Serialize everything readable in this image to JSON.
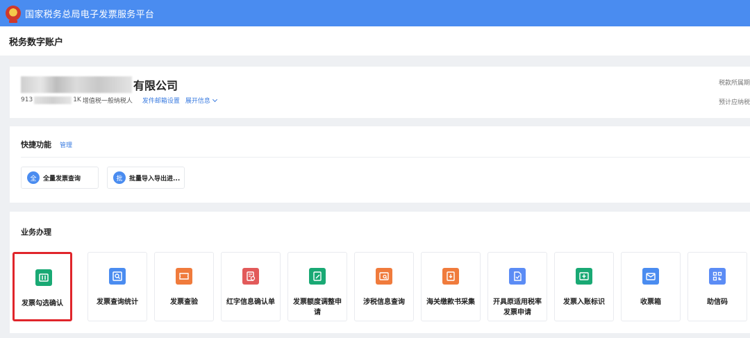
{
  "topbar": {
    "title": "国家税务总局电子发票服务平台",
    "emblem_icon": "national-tax-emblem-icon"
  },
  "page": {
    "title": "税务数字账户"
  },
  "company": {
    "name_visible": "有限公司",
    "tax_id_prefix": "913",
    "tax_id_suffix": "1K",
    "taxpayer_type": "增值税一般纳税人",
    "mail_settings_link": "发件邮箱设置",
    "expand_info_link": "展开信息",
    "right_label_1": "税款所属期",
    "right_label_2": "预计应纳税"
  },
  "quick": {
    "title": "快捷功能",
    "manage_label": "管理",
    "items": [
      {
        "icon_char": "全",
        "label": "全量发票查询"
      },
      {
        "icon_char": "批",
        "label": "批量导入导出进..."
      }
    ]
  },
  "business": {
    "title": "业务办理",
    "tiles": [
      {
        "label": "发票勾选确认",
        "icon": "invoice-check-icon",
        "color": "#19a974"
      },
      {
        "label": "发票查询统计",
        "icon": "invoice-search-icon",
        "color": "#4a8cf0"
      },
      {
        "label": "发票查验",
        "icon": "ticket-verify-icon",
        "color": "#f07b3c"
      },
      {
        "label": "红字信息确认单",
        "icon": "red-info-icon",
        "color": "#e25a5a"
      },
      {
        "label": "发票额度调整申请",
        "icon": "quota-adjust-icon",
        "color": "#19a974"
      },
      {
        "label": "涉税信息查询",
        "icon": "tax-info-search-icon",
        "color": "#f07b3c"
      },
      {
        "label": "海关缴款书采集",
        "icon": "customs-collect-icon",
        "color": "#f07b3c"
      },
      {
        "label": "开具原适用税率发票申请",
        "icon": "tax-rate-apply-icon",
        "color": "#5b8cf5"
      },
      {
        "label": "发票入账标识",
        "icon": "accounting-mark-icon",
        "color": "#19a974"
      },
      {
        "label": "收票箱",
        "icon": "inbox-mail-icon",
        "color": "#4a8cf0"
      },
      {
        "label": "助信码",
        "icon": "qr-code-icon",
        "color": "#5b8cf5"
      }
    ]
  }
}
